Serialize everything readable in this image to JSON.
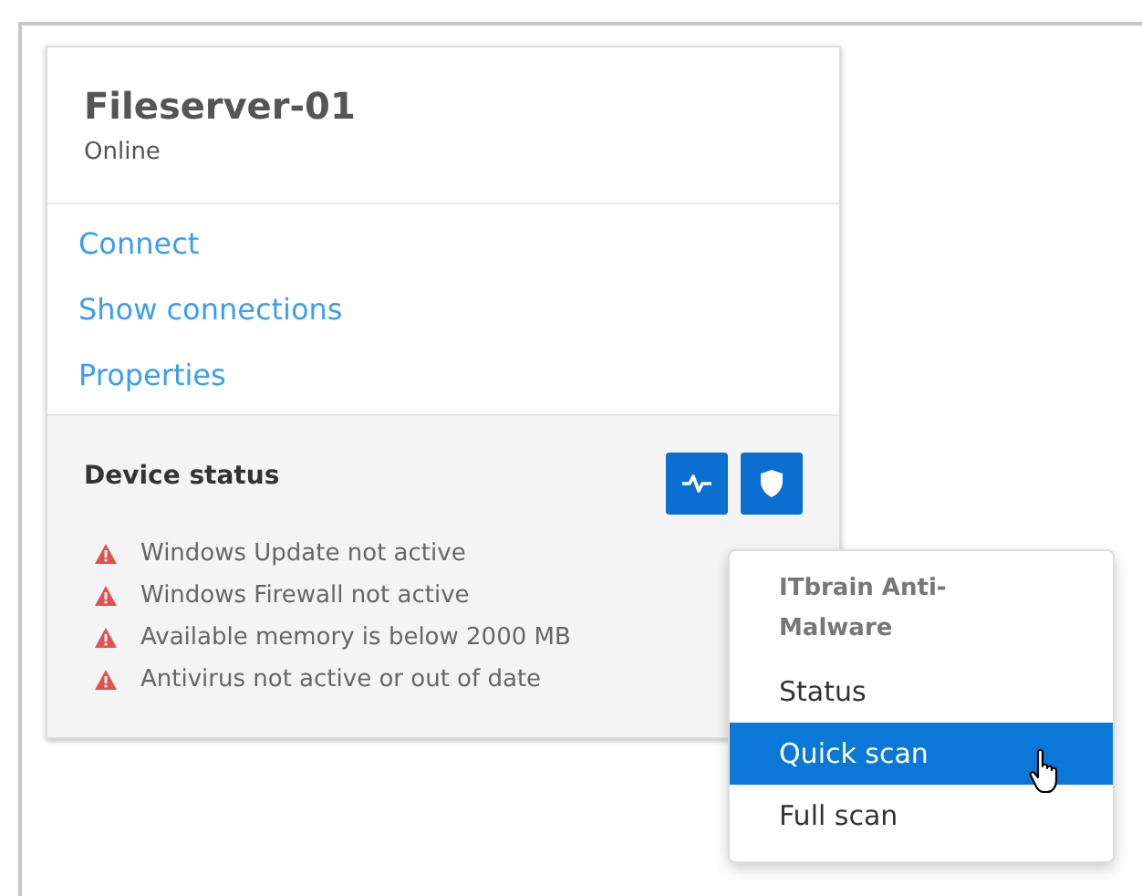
{
  "device": {
    "name": "Fileserver-01",
    "state": "Online"
  },
  "links": [
    "Connect",
    "Show connections",
    "Properties"
  ],
  "status": {
    "title": "Device status",
    "warnings": [
      "Windows Update not active",
      "Windows Firewall not active",
      "Available memory is below 2000 MB",
      "Antivirus not active or out of date"
    ]
  },
  "menu": {
    "title": "ITbrain Anti-Malware",
    "items": [
      {
        "label": "Status",
        "selected": false
      },
      {
        "label": "Quick scan",
        "selected": true
      },
      {
        "label": "Full scan",
        "selected": false
      }
    ]
  }
}
